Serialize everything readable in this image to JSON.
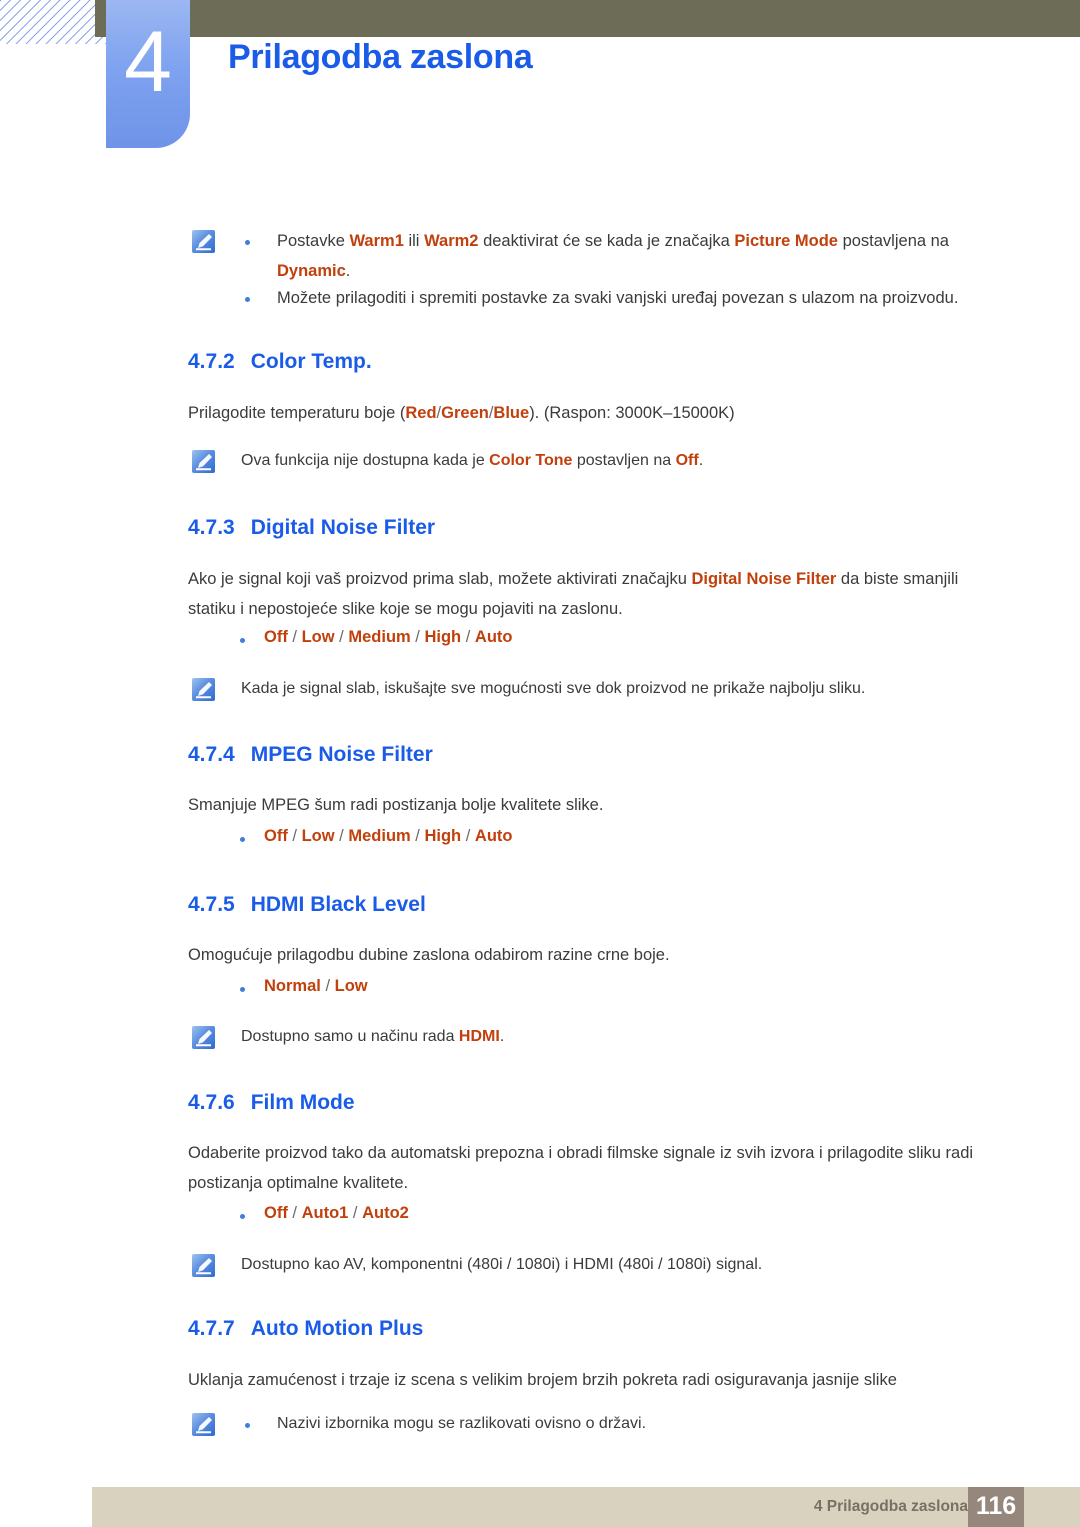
{
  "header": {
    "chapter_number": "4",
    "chapter_title": "Prilagodba zaslona",
    "olive_bar_color": "#6c6c57",
    "badge_color": "#7fa3ef",
    "title_color": "#1a5ce8"
  },
  "colors": {
    "heading_blue": "#1a5ce8",
    "highlight_orange": "#c1400c",
    "body_gray": "#3b3b3b",
    "footer_beige": "#d8d2bf",
    "page_box_taupe": "#96877d"
  },
  "intro_note": {
    "icon": "note-pencil-icon",
    "bullets": [
      {
        "segments": [
          {
            "t": "Postavke ",
            "s": "plain"
          },
          {
            "t": "Warm1",
            "s": "hl"
          },
          {
            "t": " ili ",
            "s": "plain"
          },
          {
            "t": "Warm2",
            "s": "hl"
          },
          {
            "t": " deaktivirat će se kada je značajka ",
            "s": "plain"
          },
          {
            "t": "Picture Mode",
            "s": "hl"
          },
          {
            "t": " postavljena na ",
            "s": "plain"
          },
          {
            "t": "Dynamic",
            "s": "hl"
          },
          {
            "t": ".",
            "s": "plain"
          }
        ]
      },
      {
        "segments": [
          {
            "t": "Možete prilagoditi i spremiti postavke za svaki vanjski uređaj povezan s ulazom na proizvodu.",
            "s": "plain"
          }
        ]
      }
    ]
  },
  "sections": [
    {
      "number": "4.7.2",
      "title": "Color Temp.",
      "body": [
        {
          "t": "Prilagodite temperaturu boje (",
          "s": "plain"
        },
        {
          "t": "Red",
          "s": "hl"
        },
        {
          "t": "/",
          "s": "sep"
        },
        {
          "t": "Green",
          "s": "hl"
        },
        {
          "t": "/",
          "s": "sep"
        },
        {
          "t": "Blue",
          "s": "hl"
        },
        {
          "t": "). (Raspon: 3000K–15000K)",
          "s": "plain"
        }
      ],
      "note": [
        {
          "t": "Ova funkcija nije dostupna kada je ",
          "s": "plain"
        },
        {
          "t": "Color Tone",
          "s": "hl"
        },
        {
          "t": " postavljen na ",
          "s": "plain"
        },
        {
          "t": "Off",
          "s": "hl"
        },
        {
          "t": ".",
          "s": "plain"
        }
      ]
    },
    {
      "number": "4.7.3",
      "title": "Digital Noise Filter",
      "body": [
        {
          "t": "Ako je signal koji vaš proizvod prima slab, možete aktivirati značajku ",
          "s": "plain"
        },
        {
          "t": "Digital Noise Filter",
          "s": "hl"
        },
        {
          "t": " da biste smanjili statiku i nepostojeće slike koje se mogu pojaviti na zaslonu.",
          "s": "plain"
        }
      ],
      "options": [
        "Off",
        "Low",
        "Medium",
        "High",
        "Auto"
      ],
      "note": [
        {
          "t": "Kada je signal slab, iskušajte sve mogućnosti sve dok proizvod ne prikaže najbolju sliku.",
          "s": "plain"
        }
      ]
    },
    {
      "number": "4.7.4",
      "title": "MPEG Noise Filter",
      "body": [
        {
          "t": "Smanjuje MPEG šum radi postizanja bolje kvalitete slike.",
          "s": "plain"
        }
      ],
      "options": [
        "Off",
        "Low",
        "Medium",
        "High",
        "Auto"
      ]
    },
    {
      "number": "4.7.5",
      "title": "HDMI Black Level",
      "body": [
        {
          "t": "Omogućuje prilagodbu dubine zaslona odabirom razine crne boje.",
          "s": "plain"
        }
      ],
      "options": [
        "Normal",
        "Low"
      ],
      "note": [
        {
          "t": "Dostupno samo u načinu rada ",
          "s": "plain"
        },
        {
          "t": "HDMI",
          "s": "hl"
        },
        {
          "t": ".",
          "s": "plain"
        }
      ]
    },
    {
      "number": "4.7.6",
      "title": "Film Mode",
      "body": [
        {
          "t": "Odaberite proizvod tako da automatski prepozna i obradi filmske signale iz svih izvora i prilagodite sliku radi postizanja optimalne kvalitete.",
          "s": "plain"
        }
      ],
      "options": [
        "Off",
        "Auto1",
        "Auto2"
      ],
      "note": [
        {
          "t": "Dostupno kao AV, komponentni (480i / 1080i) i HDMI (480i / 1080i) signal.",
          "s": "plain"
        }
      ]
    },
    {
      "number": "4.7.7",
      "title": "Auto Motion Plus",
      "body": [
        {
          "t": "Uklanja zamućenost i trzaje iz scena s velikim brojem brzih pokreta radi osiguravanja jasnije slike",
          "s": "plain"
        }
      ],
      "note_bulleted": [
        {
          "t": "Nazivi izbornika mogu se razlikovati ovisno o državi.",
          "s": "plain"
        }
      ]
    }
  ],
  "footer": {
    "text": "4 Prilagodba zaslona",
    "page_number": "116"
  }
}
